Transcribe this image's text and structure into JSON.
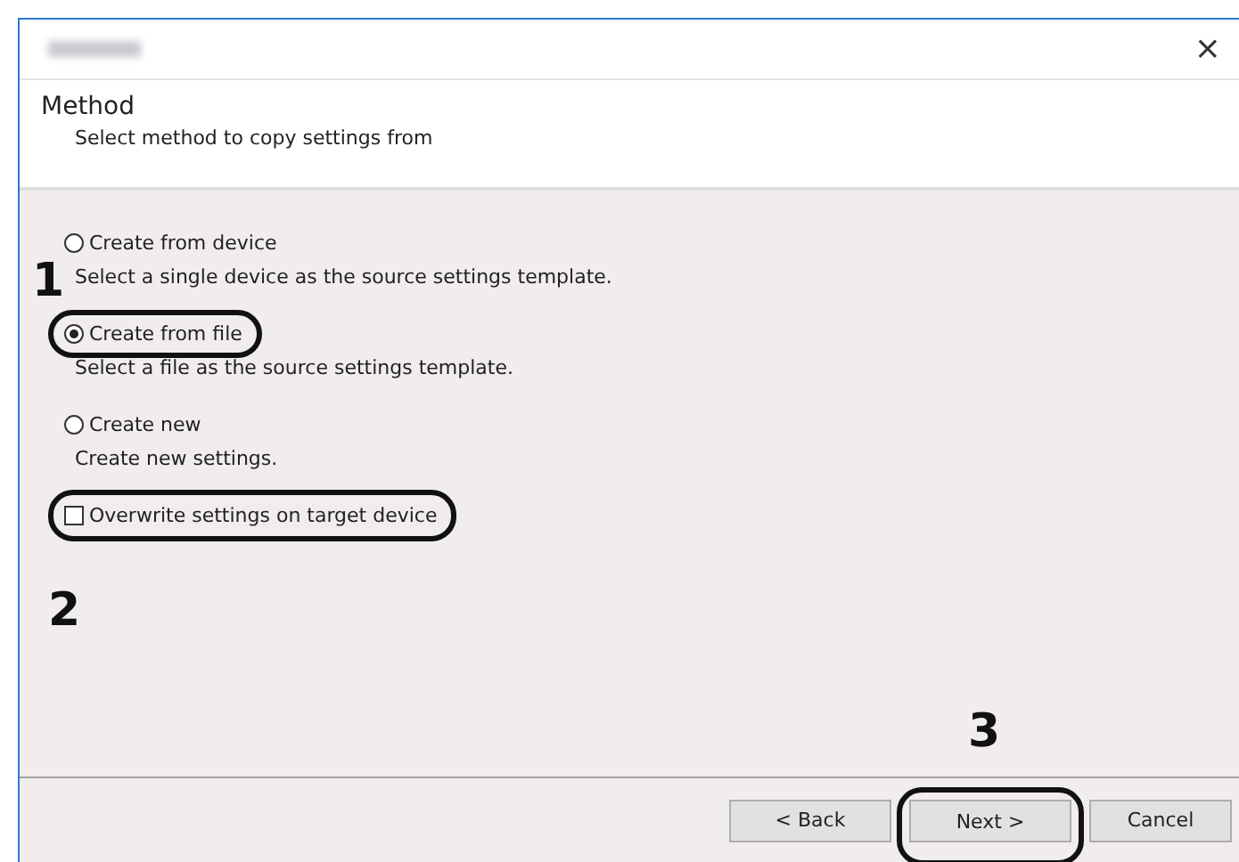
{
  "window": {
    "close": "×"
  },
  "header": {
    "title": "Method",
    "subtitle": "Select method to copy settings from"
  },
  "options": [
    {
      "kind": "radio",
      "label": "Create from device",
      "selected": false,
      "highlighted": false,
      "description": "Select a single device as the source settings template."
    },
    {
      "kind": "radio",
      "label": "Create from file",
      "selected": true,
      "highlighted": true,
      "description": "Select a file as the source settings template."
    },
    {
      "kind": "radio",
      "label": "Create new",
      "selected": false,
      "highlighted": false,
      "description": "Create new settings."
    },
    {
      "kind": "checkbox",
      "label": "Overwrite settings on target device",
      "checked": false,
      "highlighted": true
    }
  ],
  "buttons": [
    {
      "label": "< Back",
      "highlighted": false
    },
    {
      "label": "Next >",
      "highlighted": true
    },
    {
      "label": "Cancel",
      "highlighted": false
    }
  ],
  "callouts": [
    "1",
    "2",
    "3"
  ]
}
